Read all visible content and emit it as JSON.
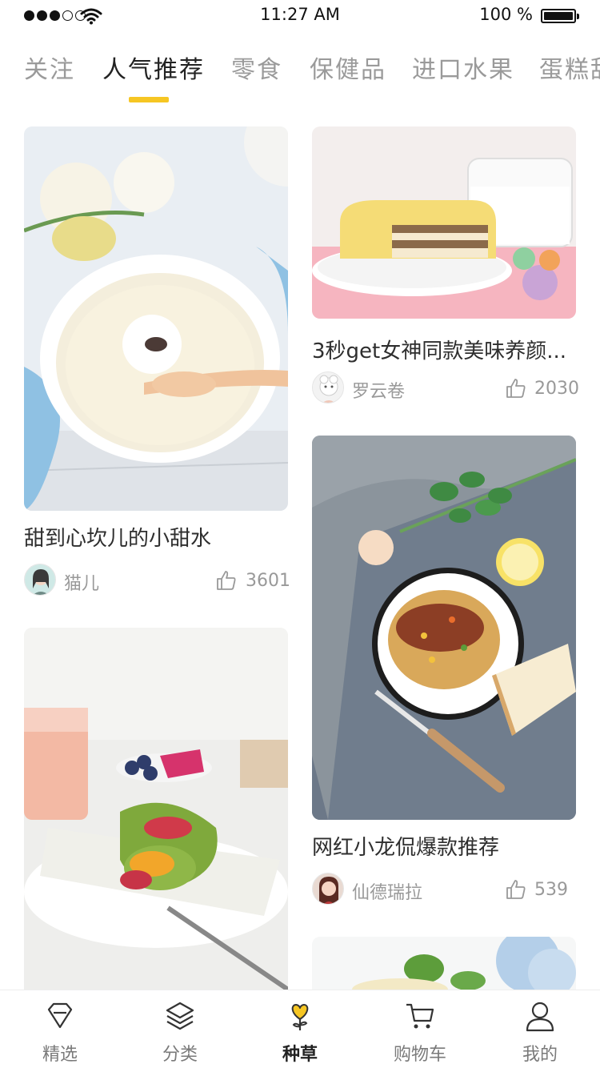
{
  "status_bar": {
    "time": "11:27 AM",
    "battery": "100 %"
  },
  "tabs": [
    {
      "label": "关注",
      "active": false
    },
    {
      "label": "人气推荐",
      "active": true
    },
    {
      "label": "零食",
      "active": false
    },
    {
      "label": "保健品",
      "active": false
    },
    {
      "label": "进口水果",
      "active": false
    },
    {
      "label": "蛋糕甜",
      "active": false
    }
  ],
  "feed": [
    {
      "title": "甜到心坎儿的小甜水",
      "author": "猫儿",
      "likes": "3601",
      "image": "sweet-soup-photo"
    },
    {
      "title": "3秒get女神同款美味养颜...",
      "author": "罗云卷",
      "likes": "2030",
      "image": "sponge-cake-photo"
    },
    {
      "title": "网红小龙侃爆款推荐",
      "author": "仙德瑞拉",
      "likes": "539",
      "image": "spaghetti-photo"
    },
    {
      "title": "",
      "author": "",
      "likes": "",
      "image": "wrap-sandwich-photo"
    },
    {
      "title": "",
      "author": "",
      "likes": "",
      "image": "flower-dessert-photo"
    }
  ],
  "bottom_nav": [
    {
      "label": "精选",
      "icon": "diamond-icon",
      "active": false
    },
    {
      "label": "分类",
      "icon": "layers-icon",
      "active": false
    },
    {
      "label": "种草",
      "icon": "heart-sprout-icon",
      "active": true
    },
    {
      "label": "购物车",
      "icon": "cart-icon",
      "active": false
    },
    {
      "label": "我的",
      "icon": "user-icon",
      "active": false
    }
  ],
  "colors": {
    "accent": "#f6c623",
    "text_primary": "#222222",
    "text_muted": "#9a9a9a"
  }
}
